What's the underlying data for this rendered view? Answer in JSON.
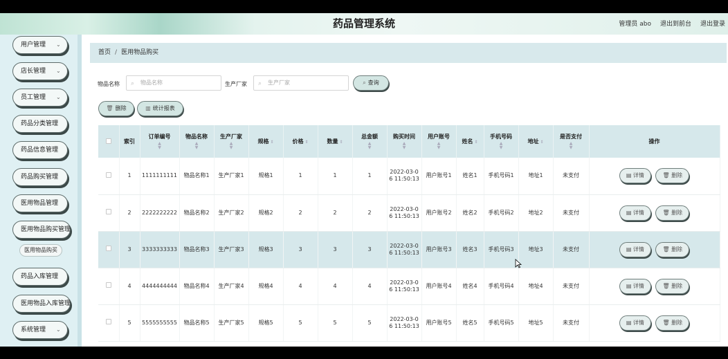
{
  "header": {
    "title": "药品管理系统",
    "user": "管理员 abo",
    "to_front": "退出到前台",
    "logout": "退出登录"
  },
  "sidebar": {
    "items": [
      {
        "label": "用户管理"
      },
      {
        "label": "店长管理"
      },
      {
        "label": "员工管理"
      },
      {
        "label": "药品分类管理"
      },
      {
        "label": "药品信息管理"
      },
      {
        "label": "药品购买管理"
      },
      {
        "label": "医用物品管理"
      },
      {
        "label": "医用物品购买管理"
      },
      {
        "label": "药品入库管理"
      },
      {
        "label": "医用物品入库管理"
      },
      {
        "label": "系统管理"
      }
    ],
    "sub_item": "医用物品购买"
  },
  "breadcrumb": {
    "home": "首页",
    "sep": "/",
    "current": "医用物品购买"
  },
  "search": {
    "name_label": "物品名称",
    "name_placeholder": "物品名称",
    "maker_label": "生产厂家",
    "maker_placeholder": "生产厂家",
    "query_button": "查询"
  },
  "actions": {
    "delete": "删除",
    "report": "统计报表"
  },
  "table": {
    "headers": [
      "索引",
      "订单编号",
      "物品名称",
      "生产厂家",
      "规格",
      "价格",
      "数量",
      "总金额",
      "购买时间",
      "用户账号",
      "姓名",
      "手机号码",
      "地址",
      "是否支付",
      "操作"
    ],
    "rows": [
      {
        "index": "1",
        "order": "1111111111",
        "name": "物品名称1",
        "maker": "生产厂家1",
        "spec": "规格1",
        "price": "1",
        "qty": "1",
        "total": "1",
        "time": "2022-03-06 11:50:13",
        "account": "用户账号1",
        "person": "姓名1",
        "phone": "手机号码1",
        "addr": "地址1",
        "paid": "未支付"
      },
      {
        "index": "2",
        "order": "2222222222",
        "name": "物品名称2",
        "maker": "生产厂家2",
        "spec": "规格2",
        "price": "2",
        "qty": "2",
        "total": "2",
        "time": "2022-03-06 11:50:13",
        "account": "用户账号2",
        "person": "姓名2",
        "phone": "手机号码2",
        "addr": "地址2",
        "paid": "未支付"
      },
      {
        "index": "3",
        "order": "3333333333",
        "name": "物品名称3",
        "maker": "生产厂家3",
        "spec": "规格3",
        "price": "3",
        "qty": "3",
        "total": "3",
        "time": "2022-03-06 11:50:13",
        "account": "用户账号3",
        "person": "姓名3",
        "phone": "手机号码3",
        "addr": "地址3",
        "paid": "未支付"
      },
      {
        "index": "4",
        "order": "4444444444",
        "name": "物品名称4",
        "maker": "生产厂家4",
        "spec": "规格4",
        "price": "4",
        "qty": "4",
        "total": "4",
        "time": "2022-03-06 11:50:13",
        "account": "用户账号4",
        "person": "姓名4",
        "phone": "手机号码4",
        "addr": "地址4",
        "paid": "未支付"
      },
      {
        "index": "5",
        "order": "5555555555",
        "name": "物品名称5",
        "maker": "生产厂家5",
        "spec": "规格5",
        "price": "5",
        "qty": "5",
        "total": "5",
        "time": "2022-03-06 11:50:13",
        "account": "用户账号5",
        "person": "姓名5",
        "phone": "手机号码5",
        "addr": "地址5",
        "paid": "未支付"
      }
    ],
    "row_detail": "详情",
    "row_delete": "删除"
  }
}
